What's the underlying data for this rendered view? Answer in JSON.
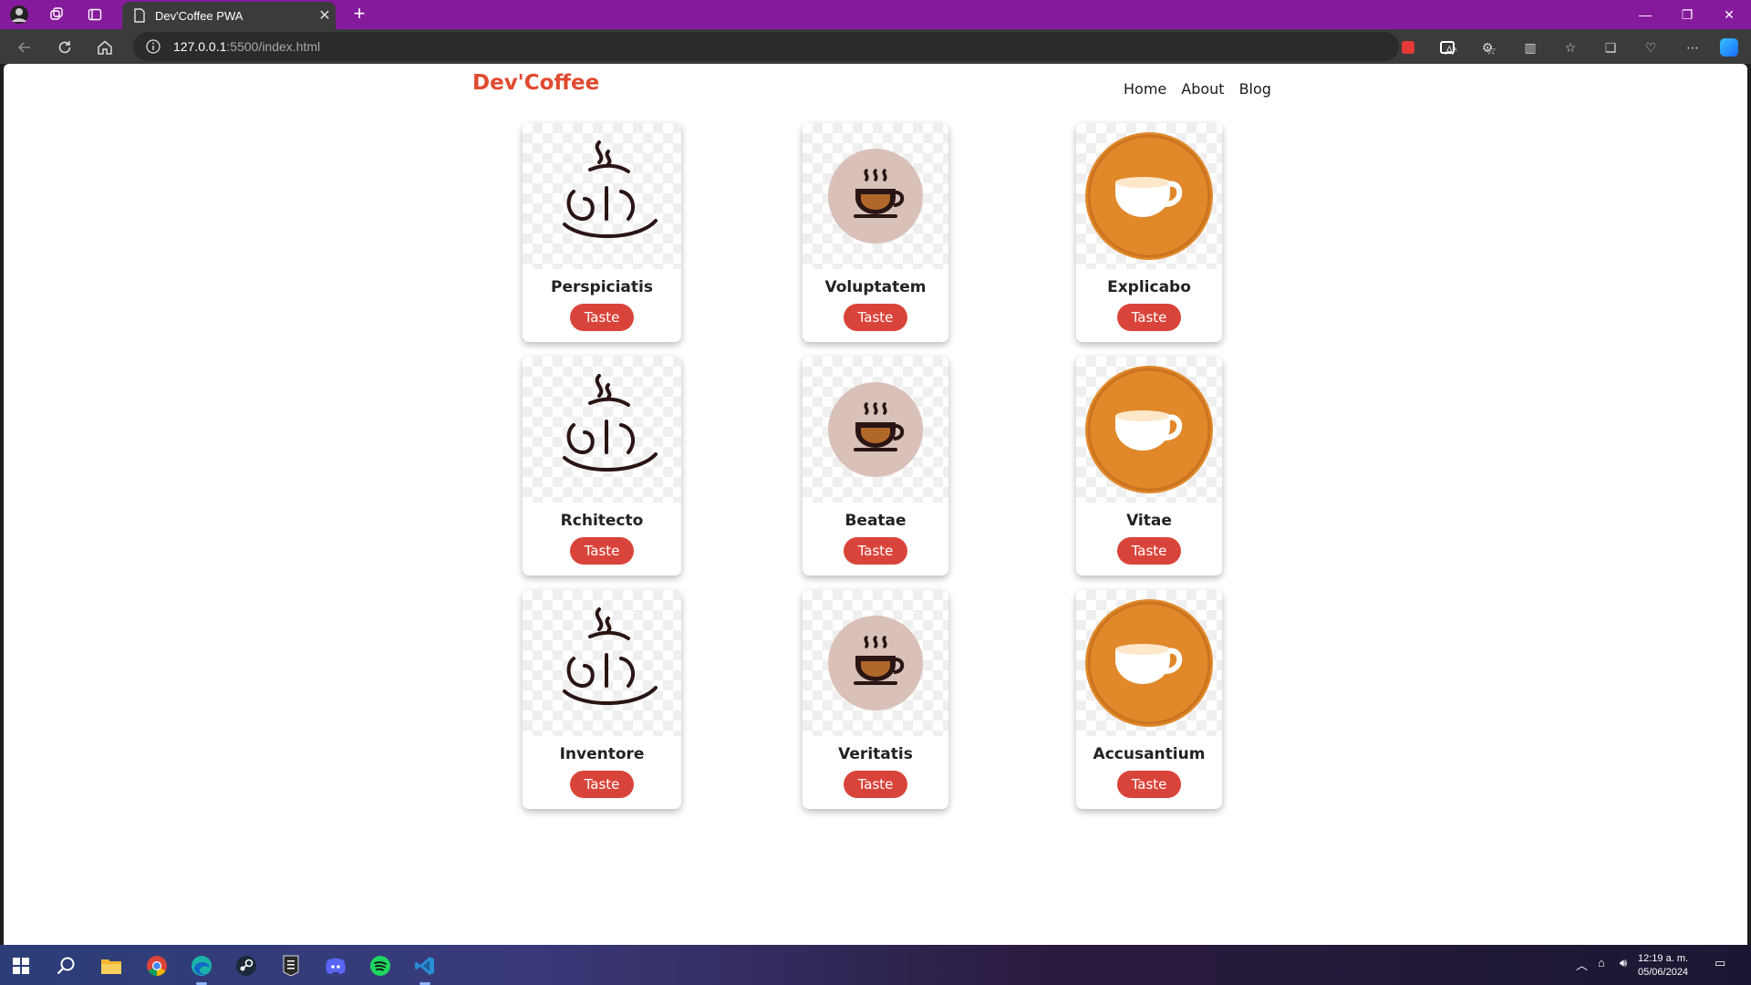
{
  "browser": {
    "tab_title": "Dev'Coffee PWA",
    "url_host": "127.0.0.1",
    "url_path": ":5500/index.html"
  },
  "site": {
    "brand": "Dev'Coffee",
    "nav": [
      "Home",
      "About",
      "Blog"
    ]
  },
  "cards": [
    {
      "name": "Perspiciatis",
      "button": "Taste",
      "icon": "steaming-cup-sketch-icon"
    },
    {
      "name": "Voluptatem",
      "button": "Taste",
      "icon": "coffee-cup-pink-circle-icon"
    },
    {
      "name": "Explicabo",
      "button": "Taste",
      "icon": "coffee-cup-orange-circle-icon"
    },
    {
      "name": "Rchitecto",
      "button": "Taste",
      "icon": "steaming-cup-sketch-icon"
    },
    {
      "name": "Beatae",
      "button": "Taste",
      "icon": "coffee-cup-pink-circle-icon"
    },
    {
      "name": "Vitae",
      "button": "Taste",
      "icon": "coffee-cup-orange-circle-icon"
    },
    {
      "name": "Inventore",
      "button": "Taste",
      "icon": "steaming-cup-sketch-icon"
    },
    {
      "name": "Veritatis",
      "button": "Taste",
      "icon": "coffee-cup-pink-circle-icon"
    },
    {
      "name": "Accusantium",
      "button": "Taste",
      "icon": "coffee-cup-orange-circle-icon"
    }
  ],
  "taskbar": {
    "time": "12:19 a. m.",
    "date": "05/06/2024"
  },
  "colors": {
    "titlebar": "#861a9c",
    "brand": "#e04a2f",
    "button": "#d9443a",
    "orange_cup": "#e0882a",
    "pink_cup": "#d9c0b8"
  }
}
